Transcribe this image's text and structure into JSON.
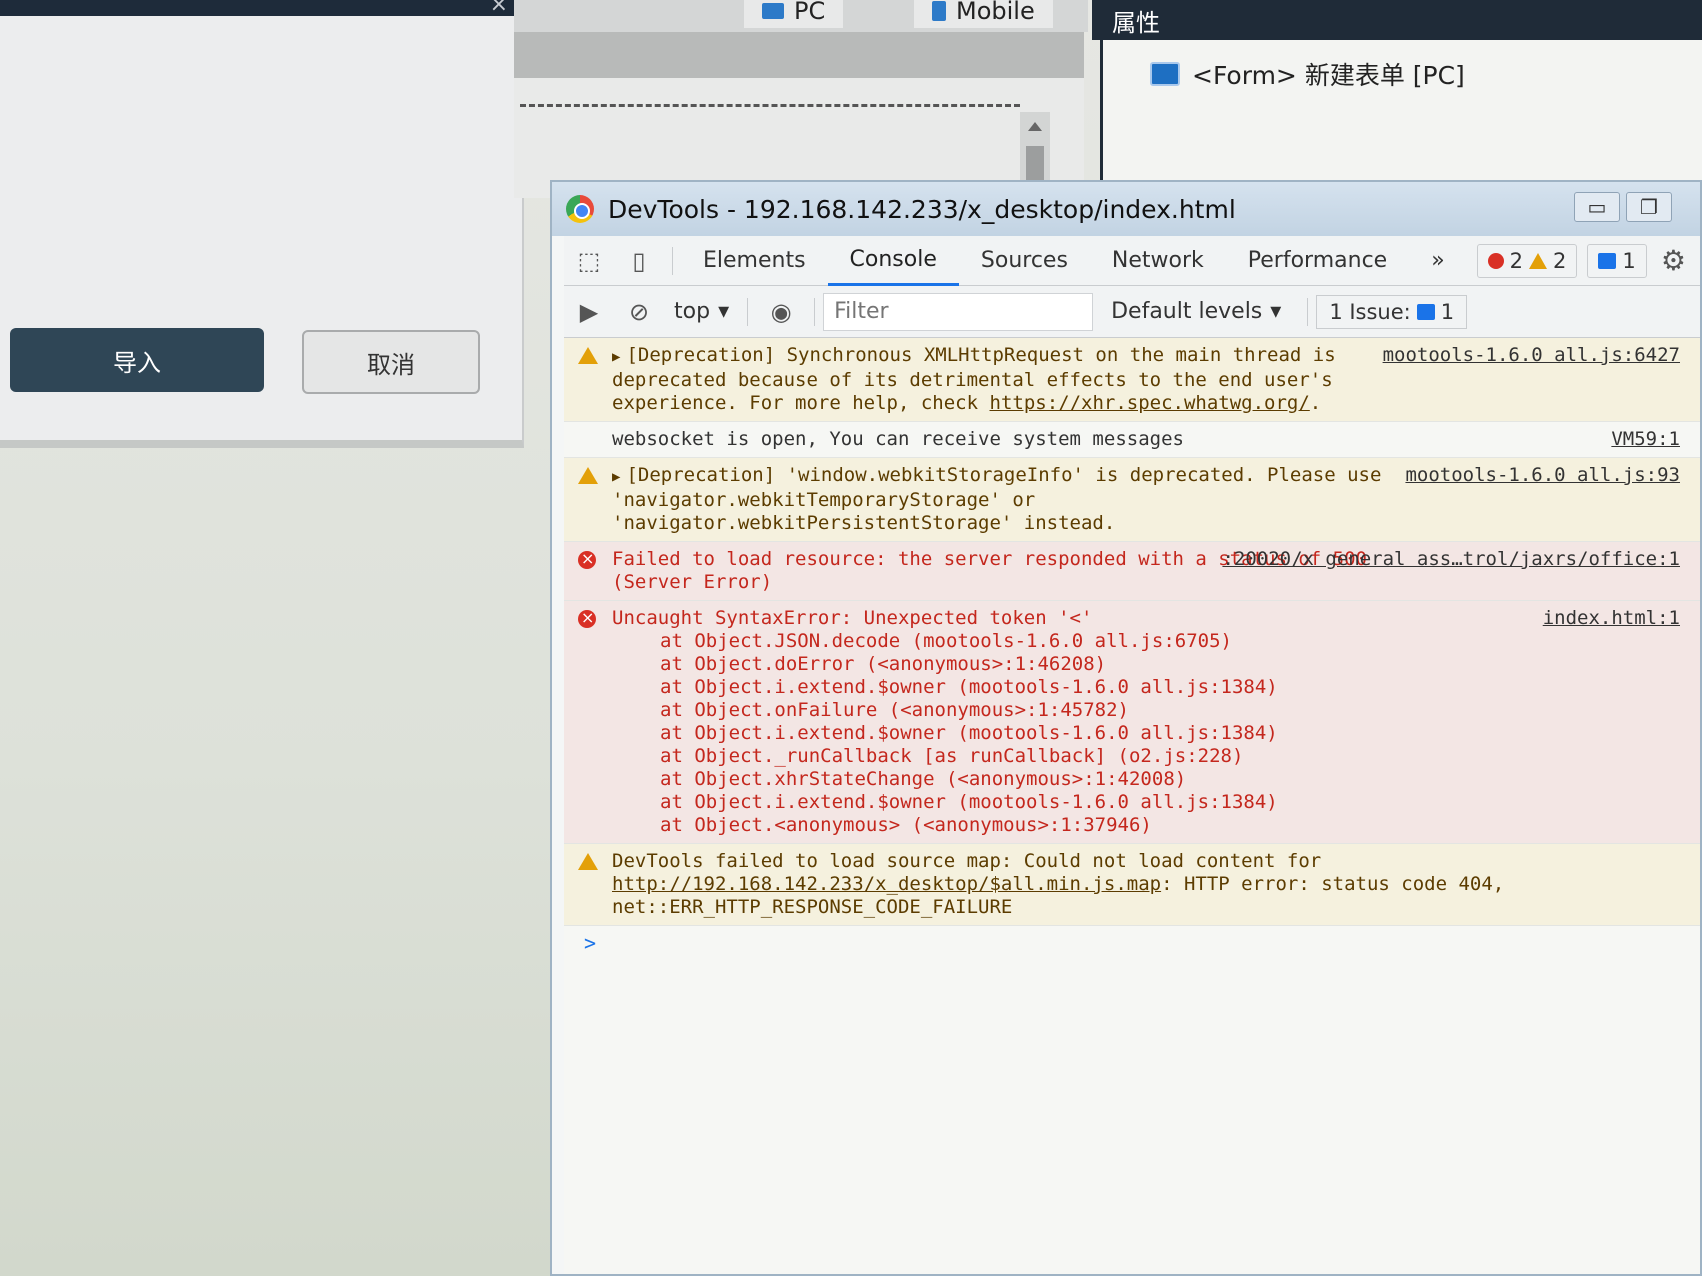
{
  "background_app": {
    "dialog": {
      "import_label": "导入",
      "cancel_label": "取消"
    },
    "designer_tabs": [
      "PC",
      "Mobile"
    ],
    "props_title": "属性",
    "form_label": "<Form> 新建表单 [PC]"
  },
  "devtools": {
    "window_title": "DevTools - 192.168.142.233/x_desktop/index.html",
    "tabs": [
      "Elements",
      "Console",
      "Sources",
      "Network",
      "Performance"
    ],
    "more_tabs": "»",
    "counts": {
      "errors": "2",
      "warnings": "2",
      "messages": "1"
    },
    "toolbar": {
      "context": "top",
      "filter_placeholder": "Filter",
      "levels": "Default levels",
      "issues_label": "1 Issue:",
      "issues_count": "1"
    },
    "messages": [
      {
        "level": "warning",
        "text": "[Deprecation] Synchronous XMLHttpRequest on the main thread is deprecated because of its detrimental effects to the end user's experience. For more help, check ",
        "link": "https://xhr.spec.whatwg.org/",
        "text_after": ".",
        "source": "mootools-1.6.0 all.js:6427"
      },
      {
        "level": "info",
        "text": "websocket is open, You can receive system messages",
        "source": "VM59:1"
      },
      {
        "level": "warning",
        "text": "[Deprecation] 'window.webkitStorageInfo' is deprecated. Please use 'navigator.webkitTemporaryStorage' or 'navigator.webkitPersistentStorage' instead.",
        "source": "mootools-1.6.0 all.js:93"
      },
      {
        "level": "error",
        "text": "Failed to load resource: the server responded with a status of 500 (Server Error)",
        "source": ":20020/x general ass…trol/jaxrs/office:1"
      },
      {
        "level": "error",
        "text": "Uncaught SyntaxError: Unexpected token '<'",
        "source": "index.html:1",
        "stack": [
          "at Object.JSON.decode (mootools-1.6.0 all.js:6705)",
          "at Object.doError (<anonymous>:1:46208)",
          "at Object.i.extend.$owner (mootools-1.6.0 all.js:1384)",
          "at Object.onFailure (<anonymous>:1:45782)",
          "at Object.i.extend.$owner (mootools-1.6.0 all.js:1384)",
          "at Object._runCallback [as runCallback] (o2.js:228)",
          "at Object.xhrStateChange (<anonymous>:1:42008)",
          "at Object.i.extend.$owner (mootools-1.6.0 all.js:1384)",
          "at Object.<anonymous> (<anonymous>:1:37946)"
        ]
      },
      {
        "level": "warning",
        "text": "DevTools failed to load source map: Could not load content for ",
        "link": "http://192.168.142.233/x_desktop/$all.min.js.map",
        "text_after": ": HTTP error: status code 404, net::ERR_HTTP_RESPONSE_CODE_FAILURE"
      }
    ],
    "prompt": ">"
  },
  "colors": {
    "accent": "#1a73e8",
    "error": "#d93025",
    "warning": "#e3a008",
    "dialog_primary": "#2f4656"
  }
}
